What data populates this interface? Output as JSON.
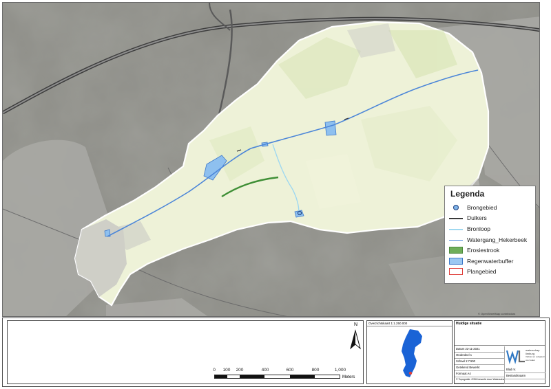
{
  "legend": {
    "title": "Legenda",
    "items": [
      {
        "key": "brongebied",
        "label": "Brongebied"
      },
      {
        "key": "dulkers",
        "label": "Dulkers"
      },
      {
        "key": "bronloop",
        "label": "Bronloop"
      },
      {
        "key": "watergang",
        "label": "Watergang_Hekerbeek"
      },
      {
        "key": "erosiestrook",
        "label": "Erosiestrook"
      },
      {
        "key": "regenwaterbuffer",
        "label": "Regenwaterbuffer"
      },
      {
        "key": "plangebied",
        "label": "Plangebied"
      }
    ]
  },
  "colors": {
    "map_background": "#8c8c86",
    "plangebied_fill": "#eef2d8",
    "plangebied_outline": "#ffffff",
    "watergang": "#4c86d8",
    "bronloop": "#9fd8f0",
    "erosiestrook": "#3f8f36",
    "regenwaterbuffer": "#8ec0ef",
    "locator_fill": "#1a63d6"
  },
  "map": {
    "copyright": "© OpenStreetMap contributors"
  },
  "north": {
    "label": "N"
  },
  "scalebar": {
    "ticks": [
      "0",
      "100",
      "200",
      "400",
      "600",
      "800",
      "1,000"
    ],
    "unit": "Meters"
  },
  "locator": {
    "title": "Overzichtskaart 1:1.250.000"
  },
  "titleblock": {
    "title": "Huidige situatie",
    "rows": [
      "Datum 23-11-2021",
      "Onderdeel 1",
      "Schaal 1:7.500",
      "Getekend Bewerkt",
      "Formaat A4",
      "© Topografie: OSM bewerkt door Waterschap"
    ],
    "logo_lines": [
      "waterschap",
      "limburg",
      "Vrijheid en veiligheid voor water"
    ],
    "status": [
      "Blad nr.",
      "Bestandsnaam"
    ]
  }
}
